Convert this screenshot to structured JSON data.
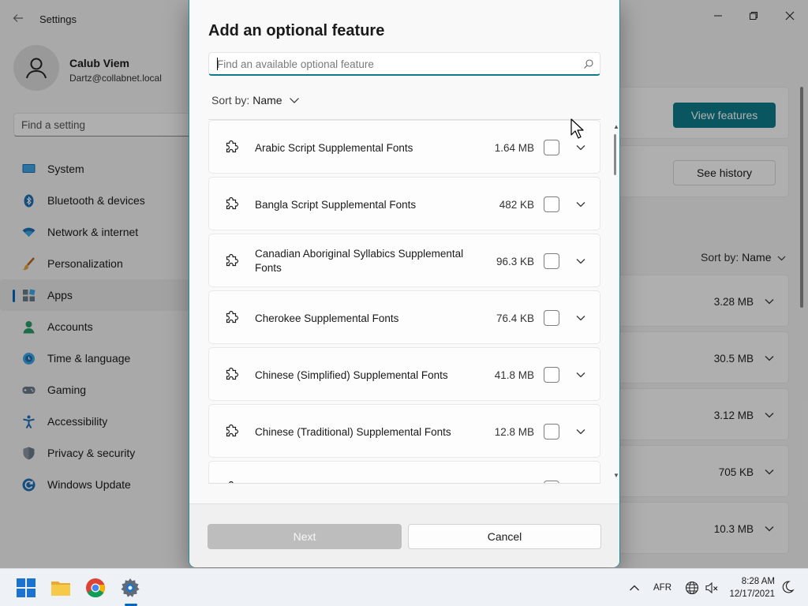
{
  "settings": {
    "title": "Settings",
    "profile": {
      "name": "Calub Viem",
      "email": "Dartz@collabnet.local"
    },
    "search_placeholder": "Find a setting",
    "nav": [
      {
        "label": "System",
        "icon": "monitor-icon"
      },
      {
        "label": "Bluetooth & devices",
        "icon": "bluetooth-icon"
      },
      {
        "label": "Network & internet",
        "icon": "wifi-icon"
      },
      {
        "label": "Personalization",
        "icon": "brush-icon"
      },
      {
        "label": "Apps",
        "icon": "apps-icon",
        "active": true
      },
      {
        "label": "Accounts",
        "icon": "person-icon"
      },
      {
        "label": "Time & language",
        "icon": "clock-globe-icon"
      },
      {
        "label": "Gaming",
        "icon": "gamepad-icon"
      },
      {
        "label": "Accessibility",
        "icon": "accessibility-icon"
      },
      {
        "label": "Privacy & security",
        "icon": "shield-icon"
      },
      {
        "label": "Windows Update",
        "icon": "update-icon"
      }
    ],
    "main": {
      "view_features_label": "View features",
      "see_history_label": "See history",
      "sort_prefix": "Sort by:",
      "sort_value": "Name",
      "installed_sizes": [
        "3.28 MB",
        "30.5 MB",
        "3.12 MB",
        "705 KB",
        "10.3 MB"
      ]
    }
  },
  "dialog": {
    "title": "Add an optional feature",
    "search_placeholder": "Find an available optional feature",
    "sort_prefix": "Sort by:",
    "sort_value": "Name",
    "features": [
      {
        "name": "Arabic Script Supplemental Fonts",
        "size": "1.64 MB",
        "checked": false
      },
      {
        "name": "Bangla Script Supplemental Fonts",
        "size": "482 KB",
        "checked": false
      },
      {
        "name": "Canadian Aboriginal Syllabics Supplemental Fonts",
        "size": "96.3 KB",
        "checked": false
      },
      {
        "name": "Cherokee Supplemental Fonts",
        "size": "76.4 KB",
        "checked": false
      },
      {
        "name": "Chinese (Simplified) Supplemental Fonts",
        "size": "41.8 MB",
        "checked": false
      },
      {
        "name": "Chinese (Traditional) Supplemental Fonts",
        "size": "12.8 MB",
        "checked": false
      }
    ],
    "next_label": "Next",
    "cancel_label": "Cancel"
  },
  "taskbar": {
    "apps": [
      "start-icon",
      "file-explorer-icon",
      "chrome-icon",
      "settings-gear-icon"
    ],
    "language": "AFR",
    "time": "8:28 AM",
    "date": "12/17/2021"
  },
  "colors": {
    "accent": "#0f7b8a",
    "nav_active": "#0067c0",
    "disabled_button": "#bdbdbd"
  }
}
